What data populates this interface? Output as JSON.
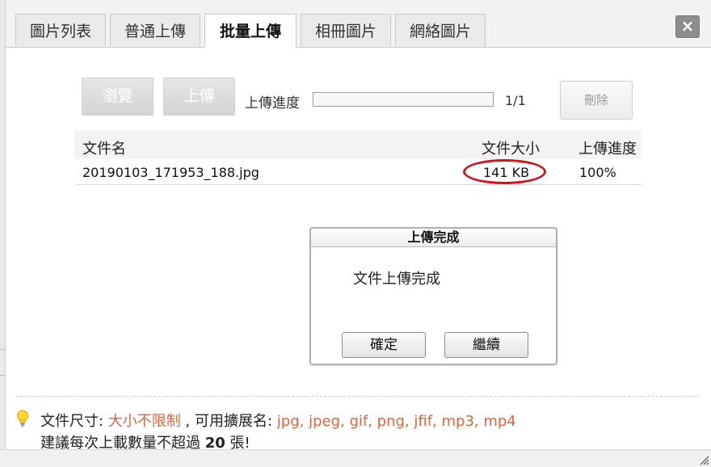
{
  "tabs": [
    {
      "label": "圖片列表",
      "active": false
    },
    {
      "label": "普通上傳",
      "active": false
    },
    {
      "label": "批量上傳",
      "active": true
    },
    {
      "label": "相冊圖片",
      "active": false
    },
    {
      "label": "網絡圖片",
      "active": false
    }
  ],
  "window": {
    "close_label": "×"
  },
  "toolbar": {
    "browse_label": "瀏覽",
    "upload_label": "上傳",
    "progress_label": "上傳進度",
    "progress_count": "1/1",
    "progress_value": 0,
    "delete_label": "刪除"
  },
  "table": {
    "headers": {
      "name": "文件名",
      "size": "文件大小",
      "progress": "上傳進度"
    },
    "rows": [
      {
        "name": "20190103_171953_188.jpg",
        "size": "141 KB",
        "progress": "100%"
      }
    ]
  },
  "dialog": {
    "title": "上傳完成",
    "message": "文件上傳完成",
    "ok_label": "確定",
    "continue_label": "繼續"
  },
  "notes": {
    "size_label": "文件尺寸:",
    "size_value": "大小不限制",
    "ext_label": ", 可用擴展名:",
    "ext_value": "jpg, jpeg, gif, png, jfif, mp3, mp4",
    "limit_prefix": "建議每次上載數量不超過",
    "limit_value": "20",
    "limit_suffix": "張!"
  },
  "icons": {
    "tip": "lightbulb-icon",
    "resize": "resize-grip-icon"
  },
  "colors": {
    "accent": "#e0653e",
    "highlight": "#d0151b"
  }
}
